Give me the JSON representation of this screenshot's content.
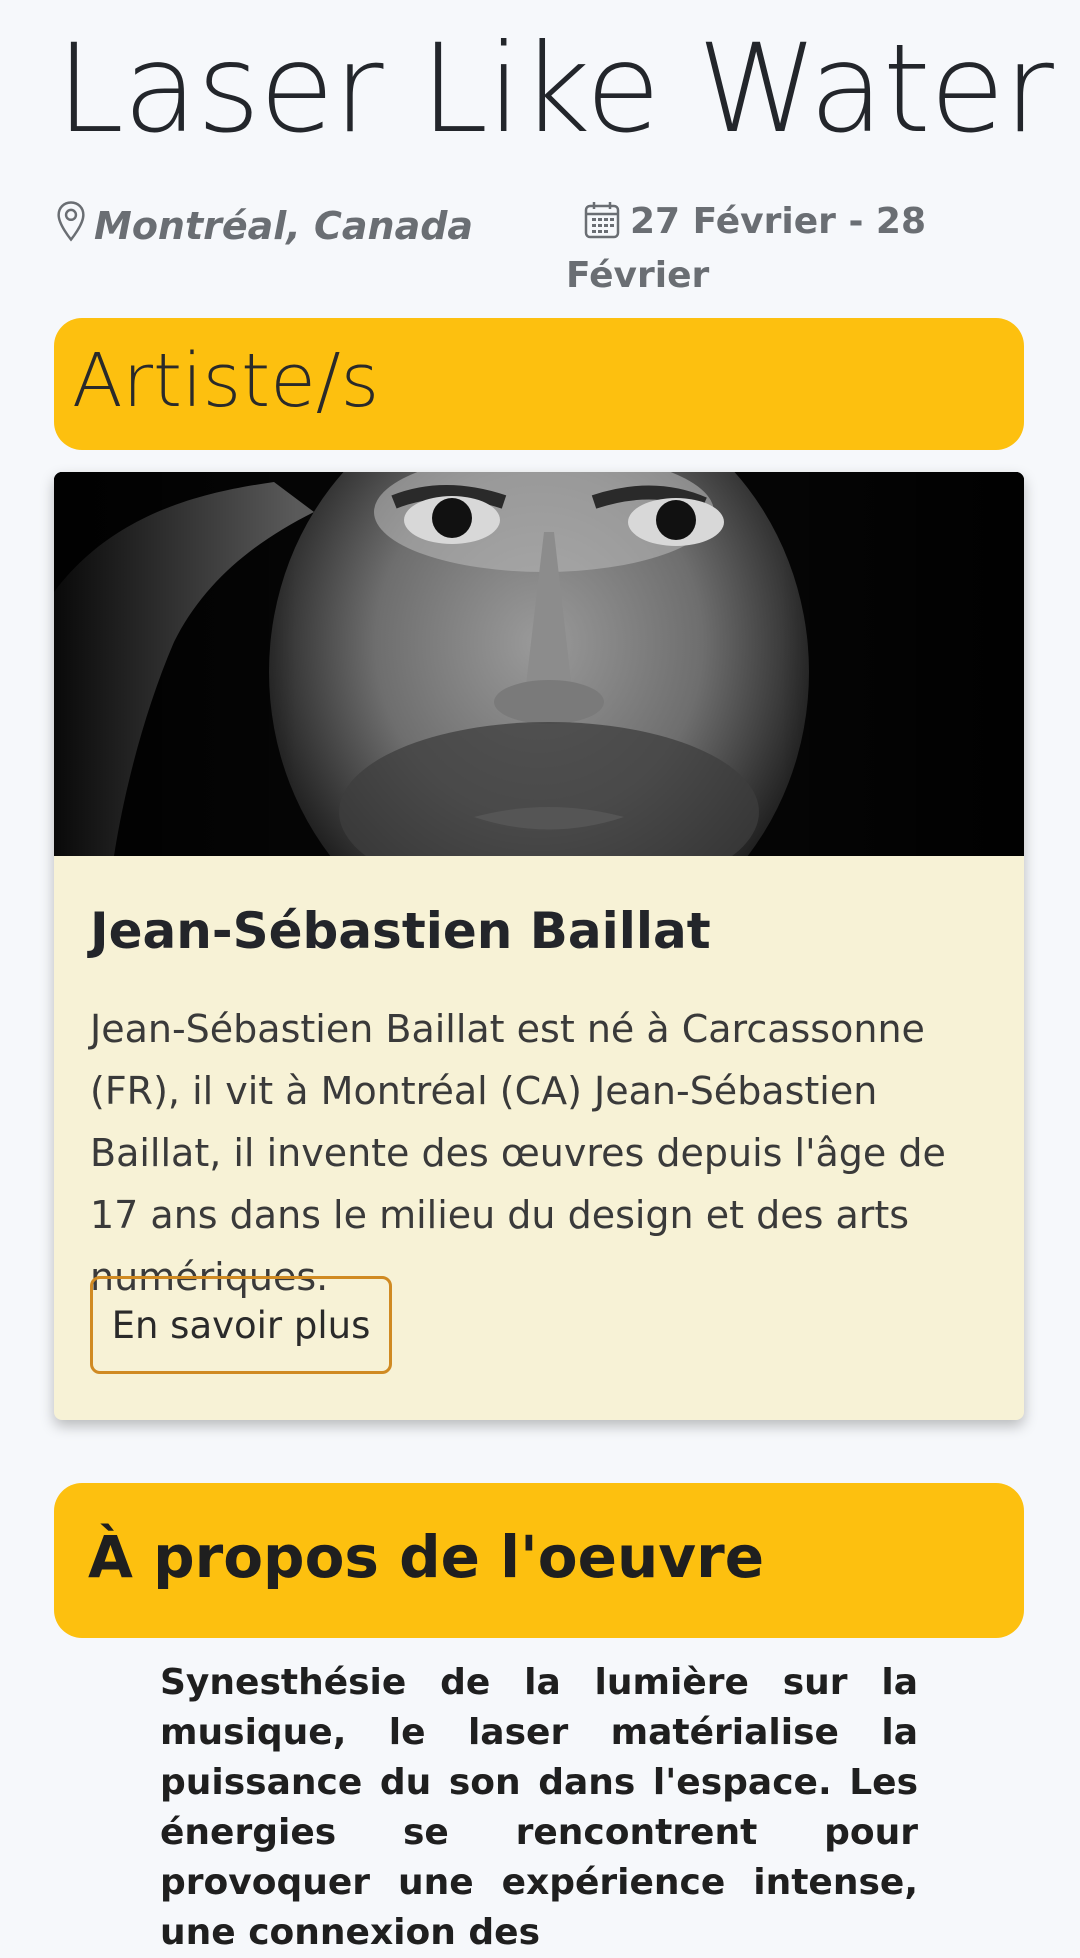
{
  "event": {
    "title": "Laser Like Water",
    "location": "Montréal, Canada",
    "dates": "27 Février - 28 Février"
  },
  "sections": {
    "artists_heading": "Artiste/s",
    "about_heading": "À propos de l'oeuvre"
  },
  "artist": {
    "name": "Jean-Sébastien Baillat",
    "bio": "Jean-Sébastien Baillat est né à Carcassonne (FR), il vit à Montréal (CA) Jean-Sébastien Baillat, il invente des œuvres depuis l'âge de 17 ans dans le milieu du design et des arts numériques.",
    "more_button": "En savoir plus",
    "photo_alt": "Portrait of the artist"
  },
  "about": {
    "text": "Synesthésie de la lumière sur la musique, le laser matérialise la puissance du son dans l'espace. Les énergies se rencontrent pour provoquer une expérience intense, une connexion des"
  },
  "icons": {
    "location": "map-pin-icon",
    "date": "calendar-icon"
  },
  "colors": {
    "accent": "#fdc00f",
    "card_bg": "#f7f2d6",
    "button_border": "#d08a22",
    "page_bg": "#f6f8fb"
  }
}
